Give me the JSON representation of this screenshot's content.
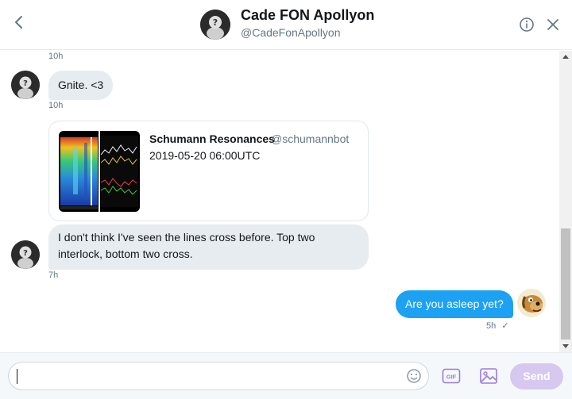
{
  "header": {
    "title": "Cade FON Apollyon",
    "handle": "@CadeFonApollyon",
    "back_icon": "chevron-left-icon",
    "info_icon": "info-icon",
    "close_icon": "close-icon"
  },
  "conversation": {
    "timestamps": [
      "10h",
      "10h",
      "7h"
    ],
    "messages": [
      {
        "text": "Gnite. <3"
      },
      {
        "text": "I don't think I've seen the lines cross before. Top two interlock, bottom two cross."
      },
      {
        "text": "Are you asleep yet?",
        "time": "5h",
        "status": "✓"
      }
    ],
    "card": {
      "name": "Schumann Resonances",
      "username": "@schumannbot",
      "text": "2019-05-20 06:00UTC"
    }
  },
  "composer": {
    "placeholder": "",
    "send_label": "Send",
    "gif_label": "GIF"
  },
  "colors": {
    "accent": "#1da1f2",
    "send_disabled": "#d7c8f0",
    "icon_purple": "#9b7bd9"
  }
}
